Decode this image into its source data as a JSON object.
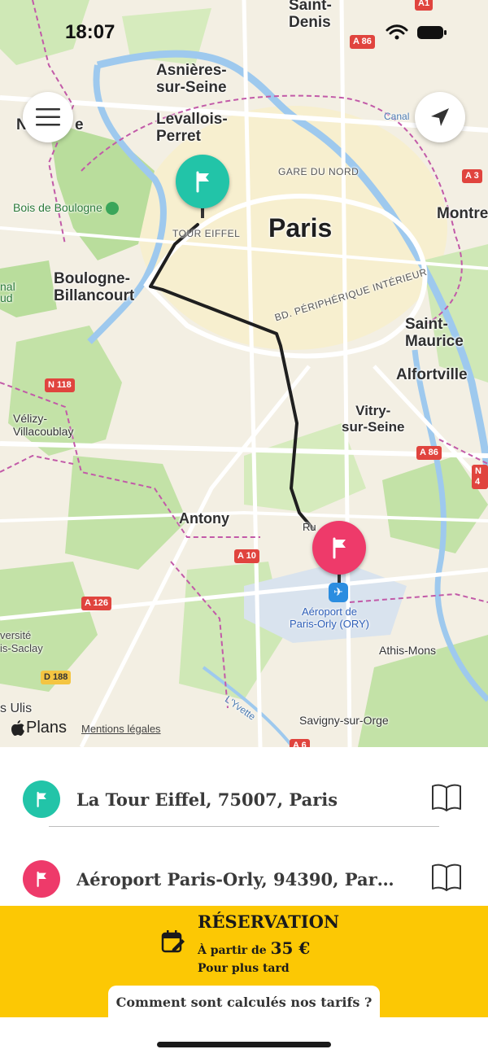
{
  "status": {
    "time": "18:07"
  },
  "map": {
    "labels": {
      "saint_denis": "Saint-\nDenis",
      "asnieres": "Asnières-\nsur-Seine",
      "levallois": "Levallois-\nPerret",
      "neuilly_partial": "N",
      "neuilly_partial2": "e",
      "gare_du_nord": "GARE DU NORD",
      "tour_eiffel": "TOUR EIFFEL",
      "paris": "Paris",
      "montreuil_partial": "Montre",
      "bois_de_boulogne": "Bois de Boulogne",
      "boulogne": "Boulogne-\nBillancourt",
      "canal_partial": "nal\nud",
      "bd_peripherique": "BD. PÉRIPHÉRIQUE INTÉRIEUR",
      "saint_maurice": "Saint-\nMaurice",
      "alfortville": "Alfortville",
      "velizy": "Vélizy-\nVillacoublay",
      "vitry": "Vitry-\nsur-Seine",
      "antony": "Antony",
      "rungis_partial": "Ru",
      "airport": "Aéroport de\nParis-Orly (ORY)",
      "universite_partial": "versité\nis-Saclay",
      "athis_mons": "Athis-Mons",
      "ulis_partial": "s Ulis",
      "savigny": "Savigny-sur-Orge",
      "yvette": "L'Yvette",
      "canal_top": "Canal"
    },
    "road_badges": {
      "a1": "A1",
      "a86_top": "A 86",
      "a3": "A 3",
      "n118": "N 118",
      "a86_right": "A 86",
      "n4_partial": "N 4",
      "a10": "A 10",
      "a126": "A 126",
      "d188": "D 188",
      "a6_partial": "A 6"
    },
    "brand": "Plans",
    "legal": "Mentions légales"
  },
  "addresses": {
    "from": "La Tour Eiffel, 75007, Paris",
    "to": "Aéroport Paris-Orly, 94390, Paray-..."
  },
  "booking": {
    "title": "RÉSERVATION",
    "price_prefix": "À partir de ",
    "price_value": "35 €",
    "later": "Pour plus tard",
    "tarif_button": "Comment sont calculés nos tarifs ?"
  },
  "colors": {
    "start_pin": "#22c4a8",
    "end_pin": "#ee3a6a",
    "booking_bg": "#fcc804",
    "route": "#1f1f1f"
  }
}
